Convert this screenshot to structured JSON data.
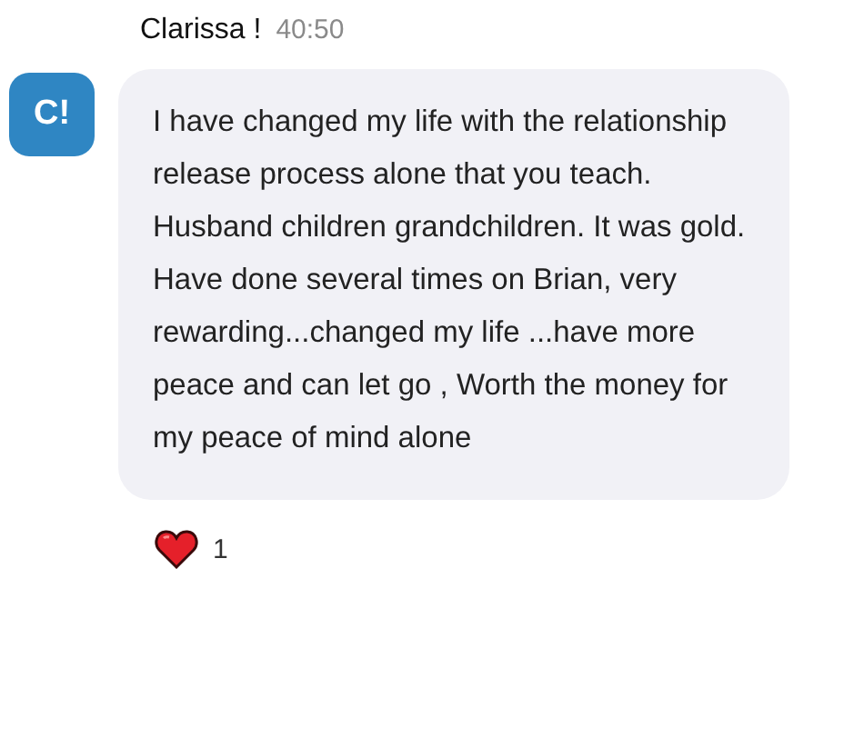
{
  "message": {
    "author": "Clarissa !",
    "time": "40:50",
    "avatar_initials": "C!",
    "text": "I have changed my life with the relationship release process alone that you teach. Husband children grandchildren. It was gold. Have done several times on Brian, very rewarding...changed my life ...have more peace and can let go , Worth the money for my peace of mind alone",
    "reactions": [
      {
        "kind": "heart",
        "count": "1"
      }
    ]
  }
}
